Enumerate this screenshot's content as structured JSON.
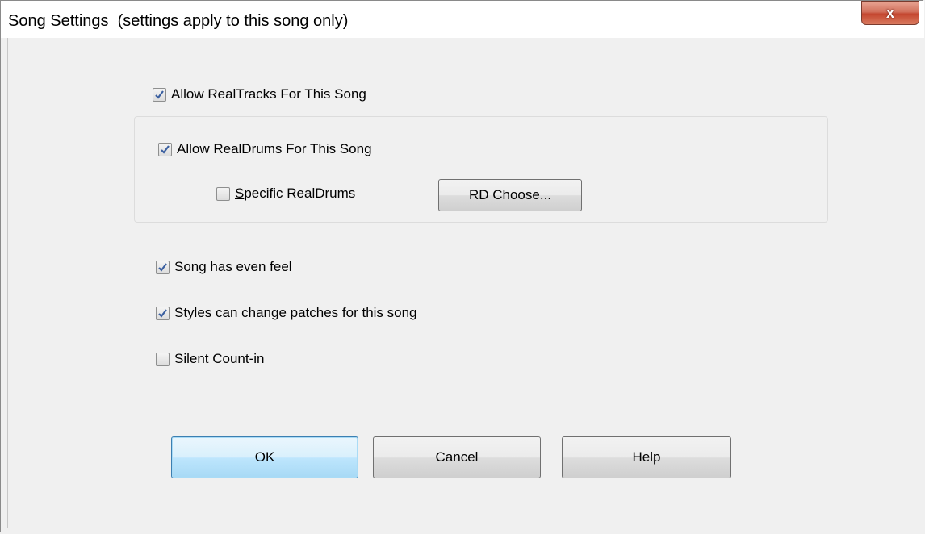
{
  "window": {
    "title": "Song Settings  (settings apply to this song only)",
    "close_glyph": "x"
  },
  "options": {
    "allow_realtracks": {
      "label": "Allow RealTracks For This Song",
      "checked": true
    },
    "allow_realdrums": {
      "label": "Allow RealDrums For This Song",
      "checked": true
    },
    "specific_realdrums": {
      "label_accel": "S",
      "label_rest": "pecific RealDrums",
      "checked": false
    },
    "even_feel": {
      "label": "Song has even feel",
      "checked": true
    },
    "styles_change_patches": {
      "label": "Styles can change patches for this song",
      "checked": true
    },
    "silent_countin": {
      "label": "Silent Count-in",
      "checked": false
    }
  },
  "buttons": {
    "rd_choose": "RD Choose...",
    "ok": "OK",
    "cancel": "Cancel",
    "help": "Help"
  },
  "colors": {
    "close_button": "#c4462f",
    "default_button_border": "#3c7fb1",
    "check_mark": "#3a5fa0"
  }
}
